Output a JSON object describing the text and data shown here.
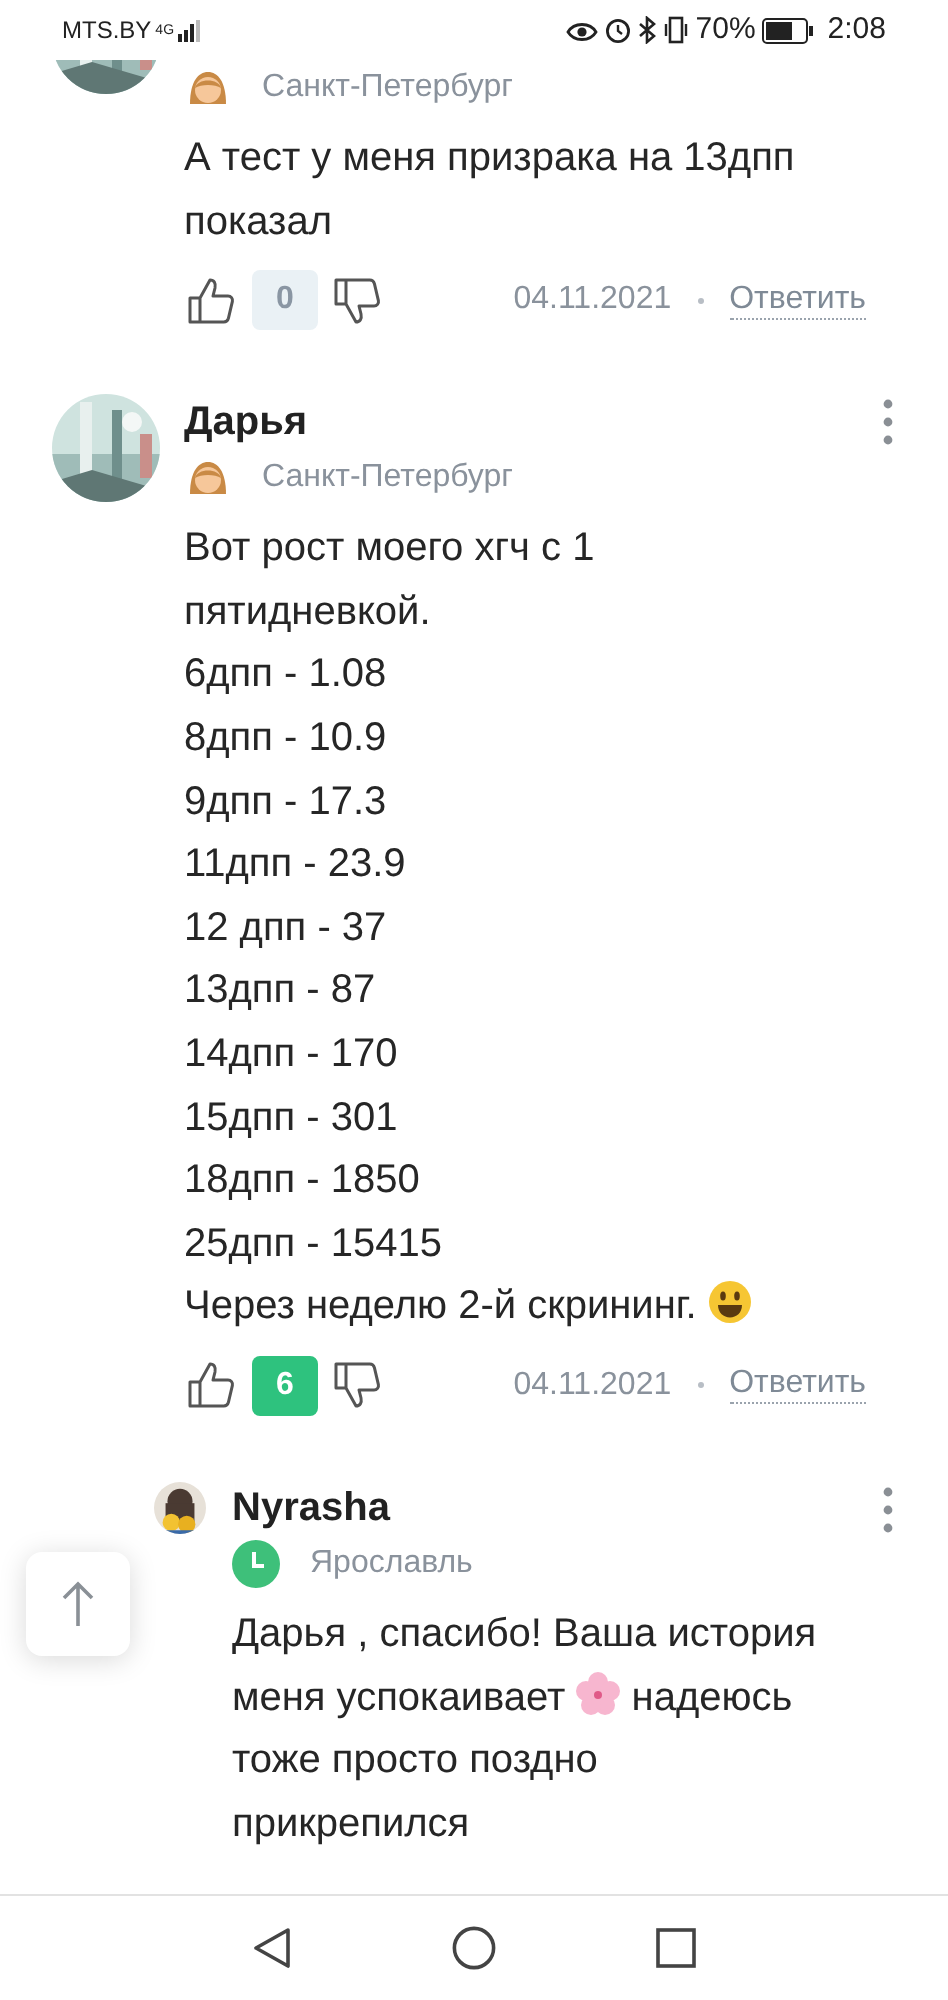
{
  "status_bar": {
    "carrier": "MTS.BY",
    "network": "4G",
    "battery": "70%",
    "time": "2:08"
  },
  "comments": [
    {
      "kind": "comment",
      "location": {
        "kind": "person",
        "text": "Санкт-Петербург"
      },
      "paragraphs": [
        [
          {
            "kind": "text",
            "text": "А тест у меня призрака на 13дпп показал"
          }
        ]
      ],
      "likes": "0",
      "positive": false,
      "date": "04.11.2021",
      "reply_label": "Ответить"
    },
    {
      "kind": "comment",
      "author": "Дарья",
      "location": {
        "kind": "person",
        "text": "Санкт-Петербург"
      },
      "paragraphs": [
        [
          {
            "kind": "text",
            "text": "Вот рост моего хгч с 1 пятидневкой."
          }
        ],
        [
          {
            "kind": "text",
            "text": "6дпп - 1.08"
          }
        ],
        [
          {
            "kind": "text",
            "text": "8дпп - 10.9"
          }
        ],
        [
          {
            "kind": "text",
            "text": "9дпп - 17.3"
          }
        ],
        [
          {
            "kind": "text",
            "text": "11дпп - 23.9"
          }
        ],
        [
          {
            "kind": "text",
            "text": "12 дпп - 37"
          }
        ],
        [
          {
            "kind": "text",
            "text": "13дпп - 87"
          }
        ],
        [
          {
            "kind": "text",
            "text": "14дпп - 170"
          }
        ],
        [
          {
            "kind": "text",
            "text": "15дпп - 301"
          }
        ],
        [
          {
            "kind": "text",
            "text": "18дпп - 1850"
          }
        ],
        [
          {
            "kind": "text",
            "text": "25дпп - 15415"
          }
        ],
        [
          {
            "kind": "text",
            "text": "Через неделю 2-й скрининг. "
          },
          {
            "kind": "smiley"
          }
        ]
      ],
      "likes": "6",
      "positive": true,
      "date": "04.11.2021",
      "reply_label": "Ответить"
    },
    {
      "kind": "reply",
      "author": "Nyrasha",
      "location": {
        "kind": "clock",
        "text": "Ярославль"
      },
      "paragraphs": [
        [
          {
            "kind": "text",
            "text": "Дарья , спасибо! Ваша история меня успокаивает "
          },
          {
            "kind": "flower"
          },
          {
            "kind": "text",
            "text": " надеюсь тоже просто поздно прикрепился"
          }
        ]
      ]
    }
  ]
}
